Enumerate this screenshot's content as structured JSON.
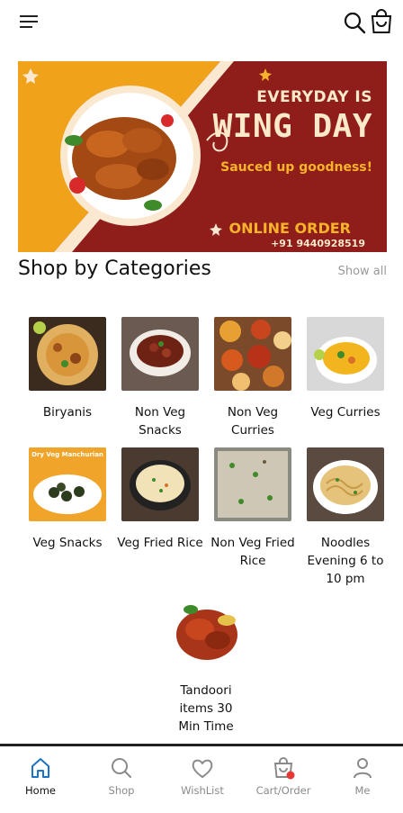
{
  "banner": {
    "line1": "EVERYDAY IS",
    "line2": "WING DAY",
    "line3": "Sauced up goodness!",
    "line4": "ONLINE ORDER",
    "line5": "+91 9440928519"
  },
  "section": {
    "title": "Shop by Categories",
    "show_all": "Show all"
  },
  "categories": [
    {
      "label": "Biryanis"
    },
    {
      "label": "Non Veg Snacks"
    },
    {
      "label": "Non Veg Curries"
    },
    {
      "label": "Veg Curries"
    },
    {
      "label": "Veg Snacks"
    },
    {
      "label": "Veg Fried Rice"
    },
    {
      "label": "Non Veg Fried Rice"
    },
    {
      "label": "Noodles Evening 6 to 10 pm"
    },
    {
      "label": "Tandoori items 30 Min Time"
    }
  ],
  "thumb_caption": "Dry Veg Manchurian",
  "nav": {
    "home": "Home",
    "shop": "Shop",
    "wishlist": "WishList",
    "cart": "Cart/Order",
    "me": "Me"
  },
  "colors": {
    "banner_red": "#8f1d1a",
    "banner_yellow": "#f0a21a",
    "accent_blue": "#1a73c6",
    "badge_red": "#e53935"
  }
}
